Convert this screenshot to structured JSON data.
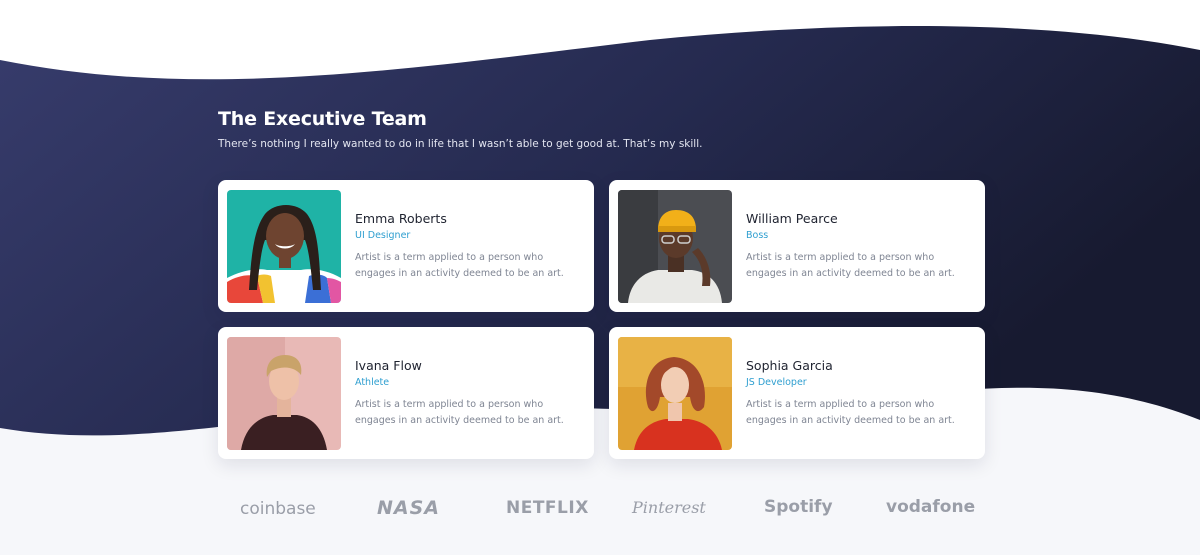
{
  "header": {
    "title": "The Executive Team",
    "subtitle": "There’s nothing I really wanted to do in life that I wasn’t able to get good at. That’s my skill."
  },
  "team": [
    {
      "name": "Emma Roberts",
      "role": "UI Designer",
      "description": "Artist is a term applied to a person who engages in an activity deemed to be an art."
    },
    {
      "name": "William Pearce",
      "role": "Boss",
      "description": "Artist is a term applied to a person who engages in an activity deemed to be an art."
    },
    {
      "name": "Ivana Flow",
      "role": "Athlete",
      "description": "Artist is a term applied to a person who engages in an activity deemed to be an art."
    },
    {
      "name": "Sophia Garcia",
      "role": "JS Developer",
      "description": "Artist is a term applied to a person who engages in an activity deemed to be an art."
    }
  ],
  "logos": [
    "coinbase",
    "NASA",
    "NETFLIX",
    "Pinterest",
    "Spotify",
    "vodafone"
  ],
  "colors": {
    "hero_start": "#363b6b",
    "hero_end": "#171a30",
    "accent": "#2f9fd0",
    "card": "#ffffff",
    "page_bg": "#f6f7fa",
    "logo_gray": "#9a9ea8"
  }
}
